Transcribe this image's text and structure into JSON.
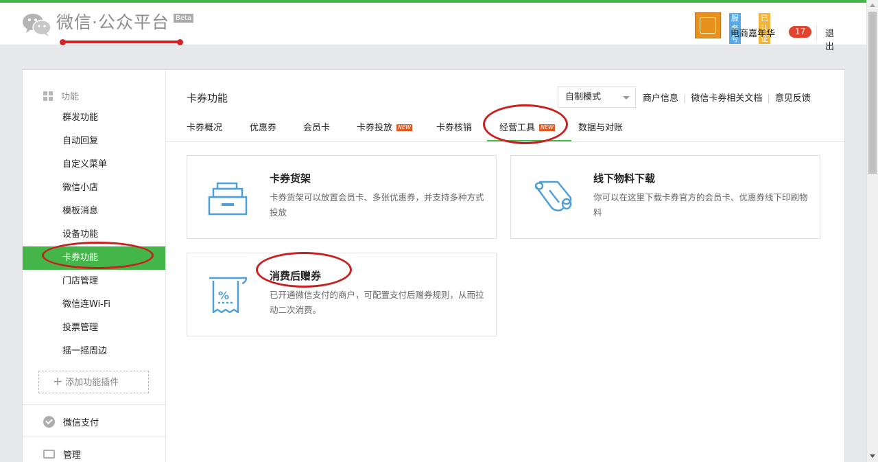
{
  "header": {
    "logo_text": "微信·公众平台",
    "beta_label": "Beta",
    "account": {
      "service_badge": "服务号",
      "verified_badge": "已认证",
      "name": "电商嘉年华",
      "notification_count": "17",
      "logout_label": "退出"
    }
  },
  "sidebar": {
    "section_title": "功能",
    "items": [
      {
        "label": "群发功能"
      },
      {
        "label": "自动回复"
      },
      {
        "label": "自定义菜单"
      },
      {
        "label": "微信小店"
      },
      {
        "label": "模板消息"
      },
      {
        "label": "设备功能"
      },
      {
        "label": "卡券功能"
      },
      {
        "label": "门店管理"
      },
      {
        "label": "微信连Wi-Fi"
      },
      {
        "label": "投票管理"
      },
      {
        "label": "摇一摇周边"
      }
    ],
    "active_item": "卡券功能",
    "add_plugin_label": "添加功能插件",
    "pay_label": "微信支付",
    "manage_label": "管理"
  },
  "content": {
    "title": "卡券功能",
    "mode_select": {
      "value": "自制模式"
    },
    "links": {
      "merchant_info": "商户信息",
      "docs": "微信卡券相关文档",
      "feedback": "意见反馈"
    },
    "tabs": [
      {
        "label": "卡券概况"
      },
      {
        "label": "优惠券"
      },
      {
        "label": "会员卡"
      },
      {
        "label": "卡券投放",
        "badge": "NEW"
      },
      {
        "label": "卡券核销"
      },
      {
        "label": "经营工具",
        "badge": "NEW"
      },
      {
        "label": "数据与对账"
      }
    ],
    "active_tab": "经营工具",
    "cards": [
      {
        "title": "卡券货架",
        "desc": "卡券货架可以放置会员卡、多张优惠券，并支持多种方式投放",
        "icon": "shelf-icon"
      },
      {
        "title": "线下物料下载",
        "desc": "你可以在这里下载卡券官方的会员卡、优惠券线下印刷物料",
        "icon": "scroll-icon"
      },
      {
        "title": "消费后赠券",
        "desc": "已开通微信支付的商户，可配置支付后赠券规则，从而拉动二次消费。",
        "icon": "receipt-percent-icon"
      }
    ]
  },
  "colors": {
    "accent": "#44b549",
    "icon_blue": "#4fa0d6",
    "annotation_red": "#c8201f"
  }
}
